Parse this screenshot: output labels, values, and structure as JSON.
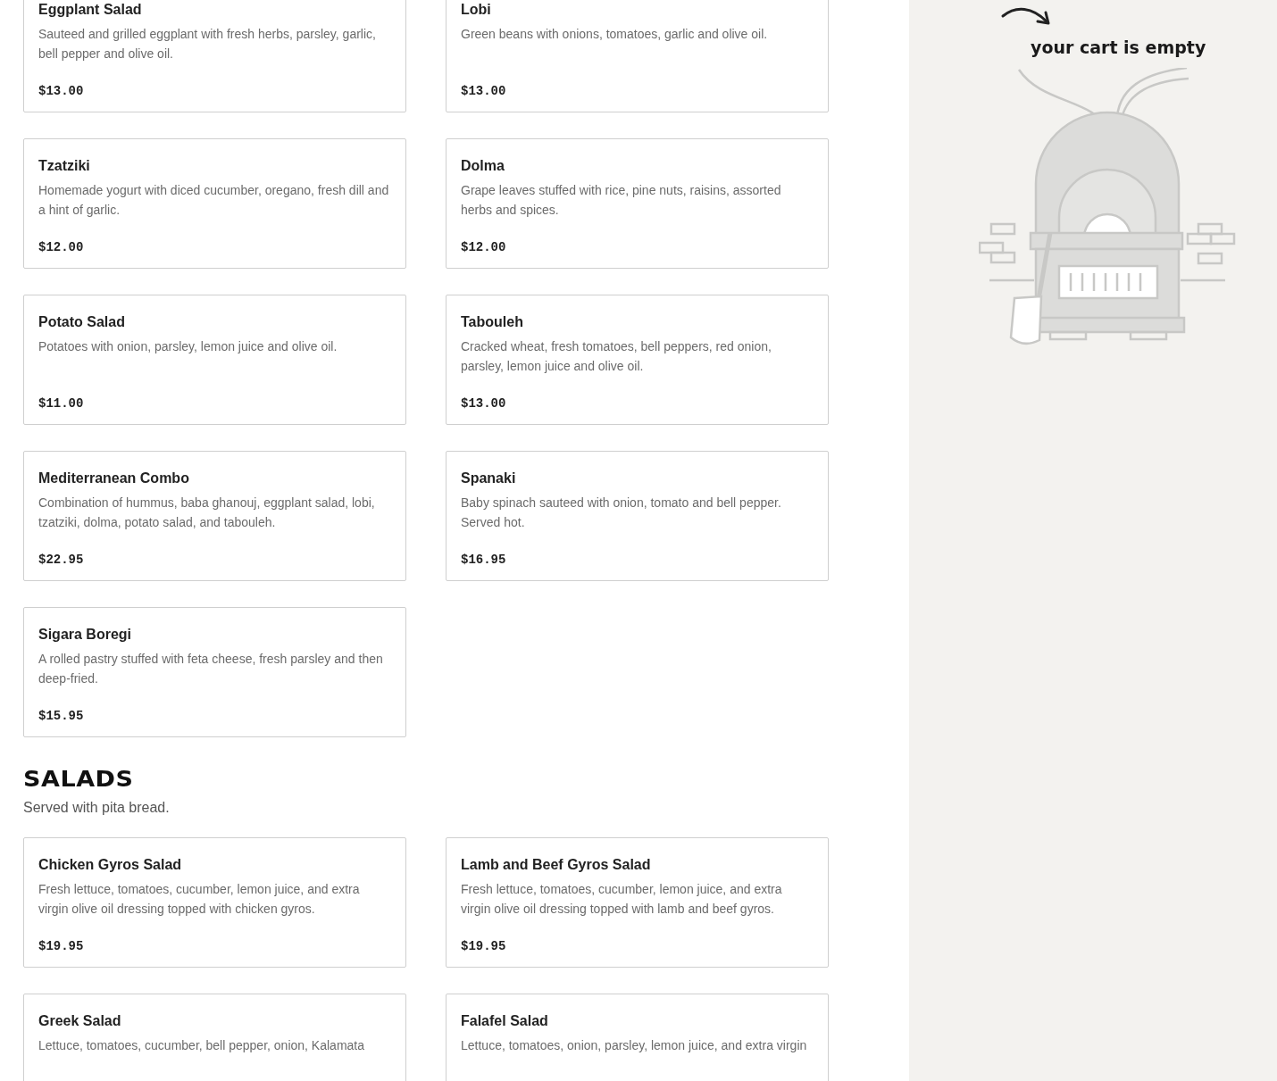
{
  "sections": [
    {
      "items": [
        {
          "name": "Eggplant Salad",
          "description": "Sauteed and grilled eggplant with fresh herbs, parsley, garlic, bell pepper and olive oil.",
          "price": "$13.00"
        },
        {
          "name": "Lobi",
          "description": "Green beans with onions, tomatoes, garlic and olive oil.",
          "price": "$13.00"
        },
        {
          "name": "Tzatziki",
          "description": "Homemade yogurt with diced cucumber, oregano, fresh dill and a hint of garlic.",
          "price": "$12.00"
        },
        {
          "name": "Dolma",
          "description": "Grape leaves stuffed with rice, pine nuts, raisins, assorted herbs and spices.",
          "price": "$12.00"
        },
        {
          "name": "Potato Salad",
          "description": "Potatoes with onion, parsley, lemon juice and olive oil.",
          "price": "$11.00"
        },
        {
          "name": "Tabouleh",
          "description": "Cracked wheat, fresh tomatoes, bell peppers, red onion, parsley, lemon juice and olive oil.",
          "price": "$13.00"
        },
        {
          "name": "Mediterranean Combo",
          "description": "Combination of hummus, baba ghanouj, eggplant salad, lobi, tzatziki, dolma, potato salad, and tabouleh.",
          "price": "$22.95"
        },
        {
          "name": "Spanaki",
          "description": "Baby spinach sauteed with onion, tomato and bell pepper. Served hot.",
          "price": "$16.95"
        },
        {
          "name": "Sigara Boregi",
          "description": "A rolled pastry stuffed with feta cheese, fresh parsley and then deep-fried.",
          "price": "$15.95"
        }
      ]
    },
    {
      "title": "SALADS",
      "note": "Served with pita bread.",
      "items": [
        {
          "name": "Chicken Gyros Salad",
          "description": "Fresh lettuce, tomatoes, cucumber, lemon juice, and extra virgin olive oil dressing topped with chicken gyros.",
          "price": "$19.95"
        },
        {
          "name": "Lamb and Beef Gyros Salad",
          "description": "Fresh lettuce, tomatoes, cucumber, lemon juice, and extra virgin olive oil dressing topped with lamb and beef gyros.",
          "price": "$19.95"
        },
        {
          "name": "Greek Salad",
          "description": "Lettuce, tomatoes, cucumber, bell pepper, onion, Kalamata"
        },
        {
          "name": "Falafel Salad",
          "description": "Lettuce, tomatoes, onion, parsley, lemon juice, and extra virgin"
        }
      ]
    }
  ],
  "cart": {
    "message": "your cart is empty"
  }
}
